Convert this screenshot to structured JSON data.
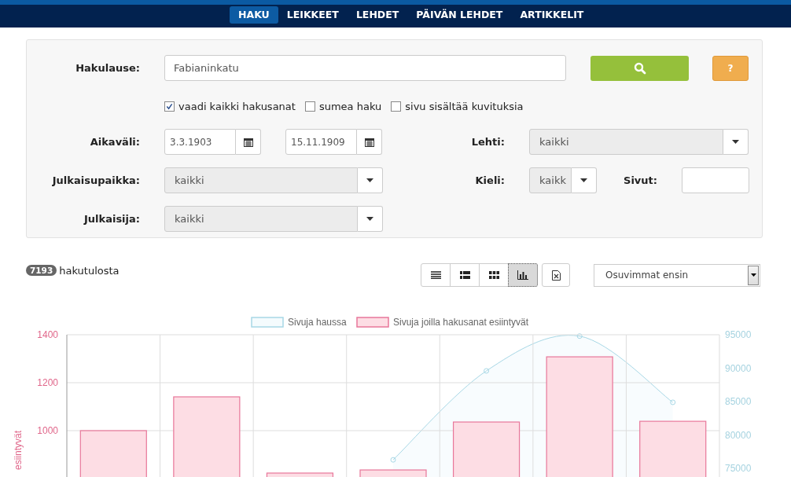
{
  "nav": {
    "tabs": [
      {
        "label": "HAKU",
        "selected": true
      },
      {
        "label": "LEIKKEET",
        "selected": false
      },
      {
        "label": "LEHDET",
        "selected": false
      },
      {
        "label": "PÄIVÄN LEHDET",
        "selected": false
      },
      {
        "label": "ARTIKKELIT",
        "selected": false
      }
    ]
  },
  "search": {
    "query_label": "Hakulause:",
    "query": "Fabianinkatu",
    "help_label": "?",
    "options": [
      {
        "label": "vaadi kaikki hakusanat",
        "checked": true
      },
      {
        "label": "sumea haku",
        "checked": false
      },
      {
        "label": "sivu sisältää kuvituksia",
        "checked": false
      }
    ],
    "date_label": "Aikaväli:",
    "date_from": "3.3.1903",
    "date_to": "15.11.1909",
    "paper_label": "Lehti:",
    "paper": "kaikki",
    "place_label": "Julkaisupaikka:",
    "place": "kaikki",
    "language_label": "Kieli:",
    "language": "kaikk",
    "pages_label": "Sivut:",
    "publisher_label": "Julkaisija:",
    "publisher": "kaikki"
  },
  "results": {
    "count": "7193",
    "count_label": "hakutulosta",
    "views": [
      {
        "kind": "list",
        "selected": false
      },
      {
        "kind": "details",
        "selected": false
      },
      {
        "kind": "grid",
        "selected": false
      },
      {
        "kind": "chart",
        "selected": true
      }
    ],
    "sort": "Osuvimmat ensin"
  },
  "chart": {
    "line_chart": {
      "chart_data": {
        "type": "area",
        "ylim": [
          73500,
          95000
        ],
        "yticks": [
          95000,
          90000,
          85000,
          80000,
          75000
        ],
        "series": [
          {
            "name": "Sivuja haussa",
            "color": "#a8d8e6",
            "marker": "circle",
            "values": [
              null,
              null,
              null,
              76300,
              89600,
              94800,
              84900
            ]
          }
        ]
      }
    },
    "bar_chart": {
      "chart_data": {
        "type": "bar",
        "ylabel": "esiintyvät",
        "ylim": [
          800,
          1400
        ],
        "yticks": [
          1400,
          1200,
          1000
        ],
        "series": [
          {
            "name": "Sivuja joilla hakusanat esiintyvät",
            "color": "#e8779a",
            "values": [
              1000,
              1141,
              823,
              836,
              1036,
              1308,
              1039
            ]
          }
        ]
      }
    }
  }
}
